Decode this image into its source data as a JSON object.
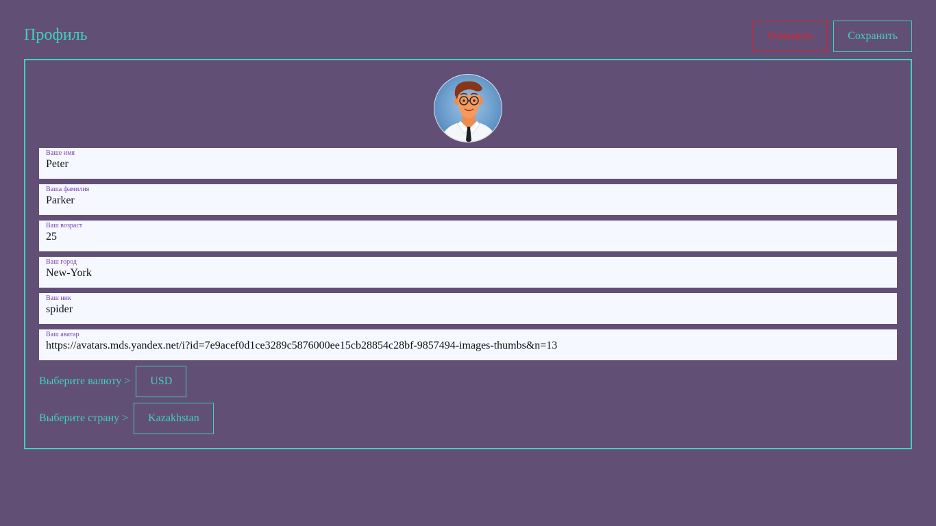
{
  "header": {
    "title": "Профиль",
    "cancel_label": "Отменить",
    "save_label": "Сохранить"
  },
  "form": {
    "fields": [
      {
        "label": "Ваше имя",
        "value": "Peter"
      },
      {
        "label": "Ваша фамилия",
        "value": "Parker"
      },
      {
        "label": "Ваш возраст",
        "value": "25"
      },
      {
        "label": "Ваш город",
        "value": "New-York"
      },
      {
        "label": "Ваш ник",
        "value": "spider"
      },
      {
        "label": "Ваш аватар",
        "value": "https://avatars.mds.yandex.net/i?id=7e9acef0d1ce3289c5876000ee15cb28854c28bf-9857494-images-thumbs&n=13"
      }
    ],
    "currency": {
      "label": "Выберите валюту >",
      "value": "USD"
    },
    "country": {
      "label": "Выберите страну >",
      "value": "Kazakhstan"
    }
  },
  "colors": {
    "background": "#624f75",
    "accent": "#40d0c0",
    "cancel": "#e0202a",
    "field_label": "#7a40b0"
  },
  "icons": {
    "avatar": "cartoon-man-avatar"
  }
}
